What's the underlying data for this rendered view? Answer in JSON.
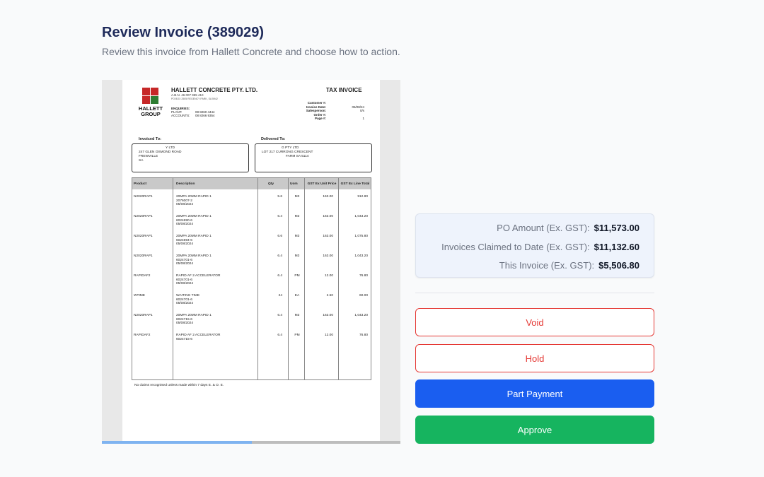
{
  "header": {
    "title": "Review Invoice (389029)",
    "subtitle": "Review this invoice from Hallett Concrete and choose how to action."
  },
  "invoice": {
    "logo_text": "HALLETT GROUP",
    "company_name": "HALLETT CONCRETE PTY. LTD.",
    "abn": "A.B.N. 46 007 955 410",
    "address": "PO BOX 2505 REGENCY PARK, SA 5942",
    "enquiries_label": "ENQUIRIES:",
    "plant_label": "PLANT:",
    "plant_phone": "08 8260 4444",
    "accounts_label": "ACCOUNTS:",
    "accounts_phone": "08 8266 9354",
    "doc_title": "TAX INVOICE",
    "meta": [
      {
        "label": "Customer #:",
        "value": ""
      },
      {
        "label": "Invoice Date:",
        "value": "05/08/24"
      },
      {
        "label": "Salesperson:",
        "value": "0/s"
      },
      {
        "label": "Order #:",
        "value": ""
      },
      {
        "label": "Page #:",
        "value": "1"
      }
    ],
    "invoiced_to_label": "Invoiced To:",
    "invoiced_to": [
      "Y LTD",
      "247 GLEN OSMOND ROAD",
      "FREWVILLE",
      "SA"
    ],
    "delivered_to_label": "Delivered To:",
    "delivered_to": [
      "G PTY LTD",
      "LOT 217 CURRONG CRESCENT",
      "",
      "FARM SA 5114"
    ],
    "columns": {
      "product": "Product",
      "description": "Description",
      "qty": "Qty",
      "uom": "Uom",
      "unit_price": "GST Ex Unit Price",
      "line_total": "GST Ex Line Total"
    },
    "rows": [
      {
        "product": "N2020RAP1",
        "desc1": "20MPA 20MM RAPID 1",
        "desc2": "2076007-2",
        "desc3": "05/08/2024",
        "qty": "5.6",
        "uom": "M3",
        "price": "163.00",
        "total": "912.80"
      },
      {
        "product": "N2020RAP1",
        "desc1": "20MPA 20MM RAPID 1",
        "desc2": "6024690-6",
        "desc3": "05/08/2024",
        "qty": "6.4",
        "uom": "M3",
        "price": "163.00",
        "total": "1,043.20"
      },
      {
        "product": "N2020RAP1",
        "desc1": "20MPA 20MM RAPID 1",
        "desc2": "6024694-6",
        "desc3": "05/08/2024",
        "qty": "6.6",
        "uom": "M3",
        "price": "163.00",
        "total": "1,075.80"
      },
      {
        "product": "N2020RAP1",
        "desc1": "20MPA 20MM RAPID 1",
        "desc2": "6024701-6",
        "desc3": "05/08/2024",
        "qty": "6.4",
        "uom": "M3",
        "price": "163.00",
        "total": "1,043.20"
      },
      {
        "product": "RAPIDAF2",
        "desc1": "RAPID AF 2 ACCELERATOR",
        "desc2": "6024701-6",
        "desc3": "05/08/2024",
        "qty": "6.4",
        "uom": "PM",
        "price": "12.00",
        "total": "76.80"
      },
      {
        "product": "WTIME",
        "desc1": "WAITING TIME",
        "desc2": "6024701-6",
        "desc3": "05/08/2024",
        "qty": "24",
        "uom": "EA",
        "price": "2.50",
        "total": "60.00"
      },
      {
        "product": "N2020RAP1",
        "desc1": "20MPA 20MM RAPID 1",
        "desc2": "6024715-6",
        "desc3": "05/08/2024",
        "qty": "6.4",
        "uom": "M3",
        "price": "163.00",
        "total": "1,043.20"
      },
      {
        "product": "RAPIDAF2",
        "desc1": "RAPID AF 2 ACCELERATOR",
        "desc2": "6024715-6",
        "desc3": "",
        "qty": "6.4",
        "uom": "PM",
        "price": "12.00",
        "total": "76.80"
      }
    ],
    "footnote": "No claims recognised unless made within 7 days E. & O. E."
  },
  "summary": {
    "po_label": "PO Amount (Ex. GST):",
    "po_value": "$11,573.00",
    "claimed_label": "Invoices Claimed to Date (Ex. GST):",
    "claimed_value": "$11,132.60",
    "this_label": "This Invoice (Ex. GST):",
    "this_value": "$5,506.80"
  },
  "actions": {
    "void": "Void",
    "hold": "Hold",
    "part_payment": "Part Payment",
    "approve": "Approve"
  }
}
